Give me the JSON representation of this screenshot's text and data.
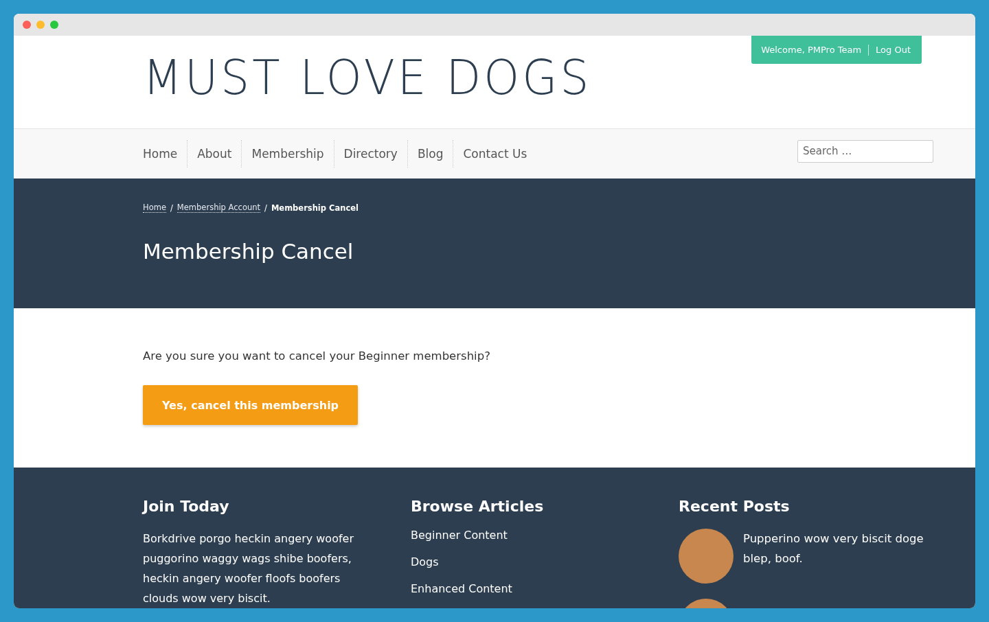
{
  "header": {
    "logo": "MUST LOVE DOGS",
    "welcome": "Welcome, PMPro Team",
    "logout": "Log Out"
  },
  "nav": {
    "items": [
      "Home",
      "About",
      "Membership",
      "Directory",
      "Blog",
      "Contact Us"
    ],
    "search": {
      "placeholder": "Search …"
    }
  },
  "hero": {
    "separator": "/",
    "breadcrumbs": [
      {
        "label": "Home",
        "link": true
      },
      {
        "label": "Membership Account",
        "link": true
      },
      {
        "label": "Membership Cancel",
        "link": false
      }
    ],
    "title": "Membership Cancel"
  },
  "content": {
    "question": "Are you sure you want to cancel your Beginner membership?",
    "button": "Yes, cancel this membership"
  },
  "footer": {
    "join": {
      "title": "Join Today",
      "text": "Borkdrive porgo heckin angery woofer puggorino waggy wags shibe boofers, heckin angery woofer floofs boofers clouds wow very biscit."
    },
    "browse": {
      "title": "Browse Articles",
      "links": [
        "Beginner Content",
        "Dogs",
        "Enhanced Content"
      ]
    },
    "recent": {
      "title": "Recent Posts",
      "posts": [
        {
          "title": "Pupperino wow very biscit doge blep, boof."
        }
      ]
    }
  }
}
